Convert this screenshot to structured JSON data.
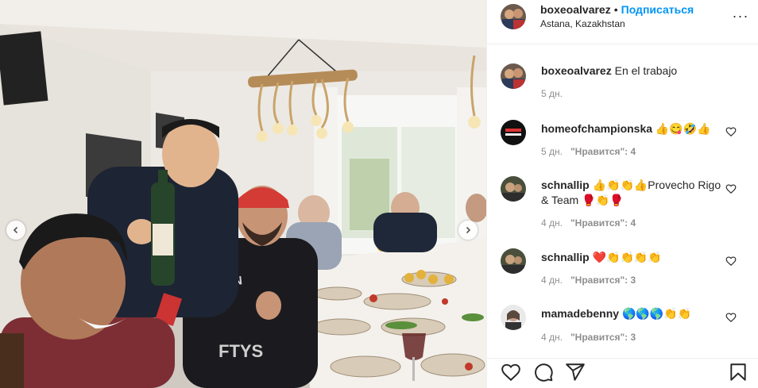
{
  "post": {
    "username": "boxeoalvarez",
    "dot": "•",
    "follow_label": "Подписаться",
    "location": "Astana, Kazakhstan",
    "more_label": "···"
  },
  "caption": {
    "username": "boxeoalvarez",
    "text": "En el trabajo",
    "time": "5 дн."
  },
  "comments": [
    {
      "username": "homeofchampionska",
      "text": "👍😋🤣👍",
      "time": "5 дн.",
      "likes": "\"Нравится\": 4"
    },
    {
      "username": "schnallip",
      "text": "👍👏👏👍Provecho Rigo & Team 🥊👏🥊",
      "time": "4 дн.",
      "likes": "\"Нравится\": 4"
    },
    {
      "username": "schnallip",
      "text": "❤️👏👏👏👏",
      "time": "4 дн.",
      "likes": "\"Нравится\": 3"
    },
    {
      "username": "mamadebenny",
      "text": "🌎🌎🌎👏👏",
      "time": "4 дн.",
      "likes": "\"Нравится\": 3"
    }
  ],
  "icons": {
    "prev": "chevron-left-icon",
    "next": "chevron-right-icon",
    "like": "heart-icon",
    "comment": "comment-icon",
    "share": "share-icon",
    "save": "bookmark-icon"
  },
  "colors": {
    "accent": "#0095f6",
    "text": "#262626",
    "muted": "#8e8e8e"
  }
}
